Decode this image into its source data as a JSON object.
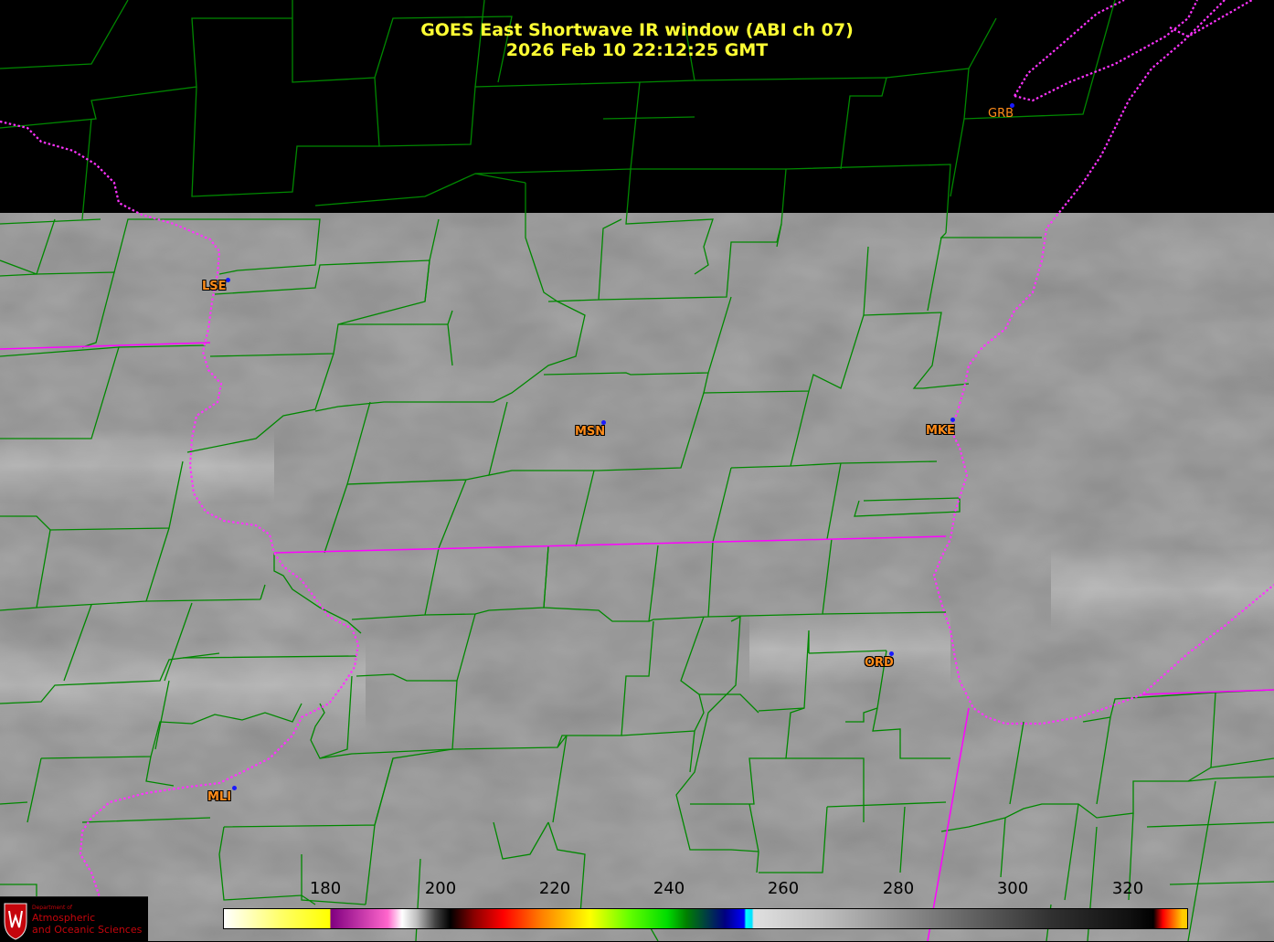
{
  "header": {
    "title_line1": "GOES East Shortwave IR window (ABI ch 07)",
    "title_line2": "2026 Feb 10  22:12:25 GMT"
  },
  "stations": [
    {
      "id": "LSE"
    },
    {
      "id": "MSN"
    },
    {
      "id": "MKE"
    },
    {
      "id": "ORD"
    },
    {
      "id": "MLI"
    },
    {
      "id": "GRB"
    }
  ],
  "colorbar": {
    "ticks": [
      "180",
      "200",
      "220",
      "240",
      "260",
      "280",
      "300",
      "320"
    ]
  },
  "logo": {
    "line_small": "Department of",
    "line1": "Atmospheric",
    "line2": "and Oceanic Sciences"
  },
  "colors": {
    "title": "#ffff33",
    "county_lines": "#008800",
    "state_lines": "#ff00ff",
    "station_label": "#ff8c1a",
    "station_dot": "#1a1aff"
  },
  "icons": [
    "university-crest-icon"
  ]
}
